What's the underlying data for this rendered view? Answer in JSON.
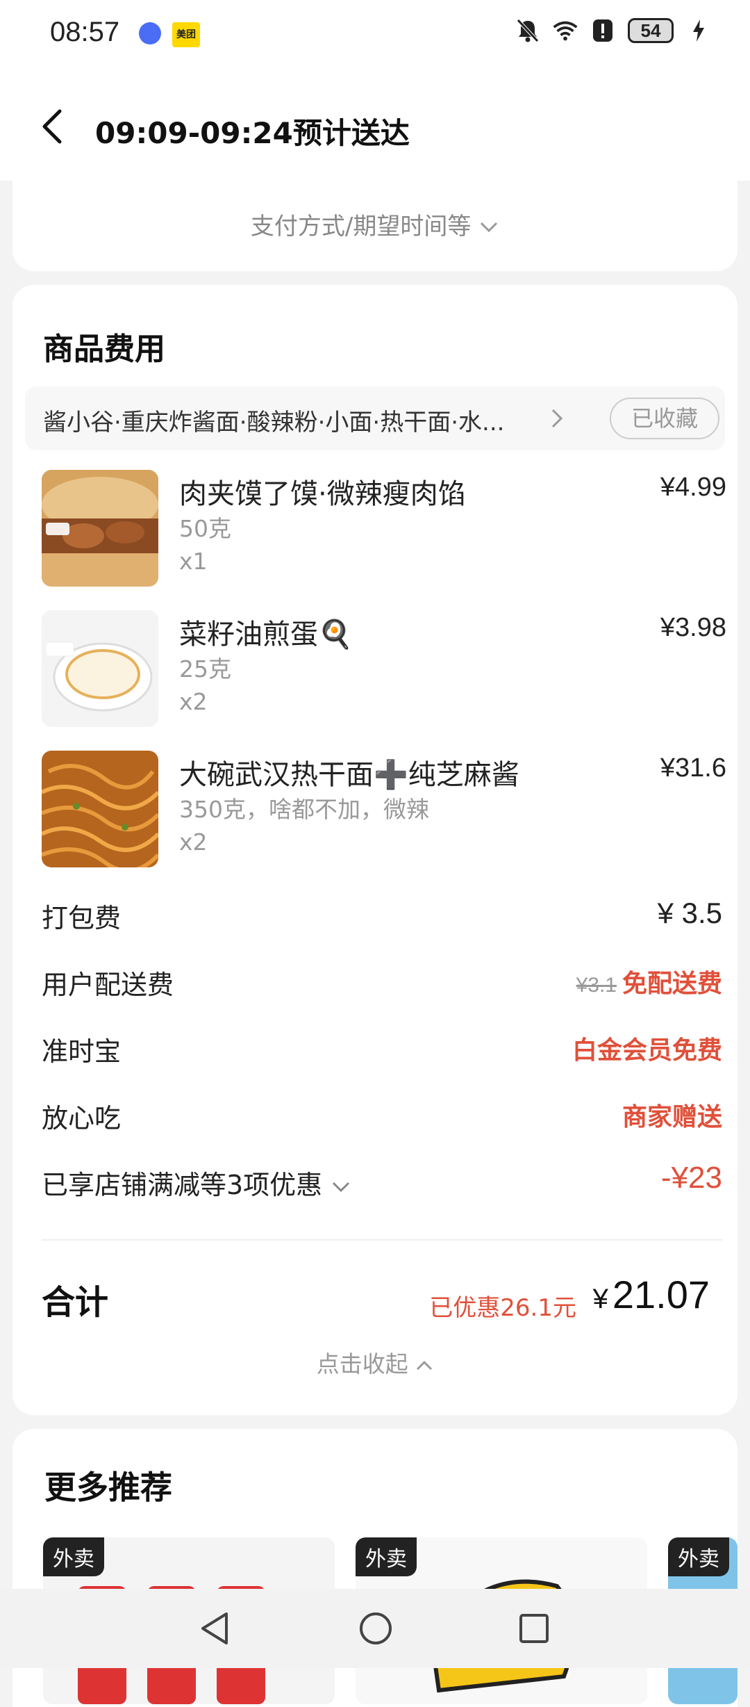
{
  "status_bar": {
    "time": "08:57",
    "app_badge": "美团",
    "battery": "54"
  },
  "header": {
    "title": "09:09-09:24预计送达"
  },
  "payment": {
    "label": "支付方式/期望时间等"
  },
  "goods": {
    "section_title": "商品费用",
    "store_name": "酱小谷·重庆炸酱面·酸辣粉·小面·热干面·水...",
    "favorited_label": "已收藏",
    "items": [
      {
        "name": "肉夹馍了馍·微辣瘦肉馅",
        "spec": "50克",
        "qty": "x1",
        "price": "¥4.99"
      },
      {
        "name": "菜籽油煎蛋🍳",
        "spec": "25克",
        "qty": "x2",
        "price": "¥3.98"
      },
      {
        "name": "大碗武汉热干面➕纯芝麻酱",
        "spec": "350克，啥都不加，微辣",
        "qty": "x2",
        "price": "¥31.6"
      }
    ]
  },
  "fees": {
    "packing_label": "打包费",
    "packing_value": "¥ 3.5",
    "delivery_label": "用户配送费",
    "delivery_original": "¥3.1",
    "delivery_value": "免配送费",
    "ontime_label": "准时宝",
    "ontime_value": "白金会员免费",
    "safe_label": "放心吃",
    "safe_value": "商家赠送",
    "discount_label": "已享店铺满减等3项优惠",
    "discount_value": "-¥23"
  },
  "summary": {
    "total_label": "合计",
    "saved_text": "已优惠26.1元",
    "total_currency": "¥",
    "total_value": "21.07",
    "collapse_label": "点击收起"
  },
  "recommendations": {
    "title": "更多推荐",
    "tags": [
      "外卖",
      "外卖",
      "外卖"
    ]
  },
  "colors": {
    "accent_red": "#e0503a",
    "background": "#f3f3f3"
  }
}
